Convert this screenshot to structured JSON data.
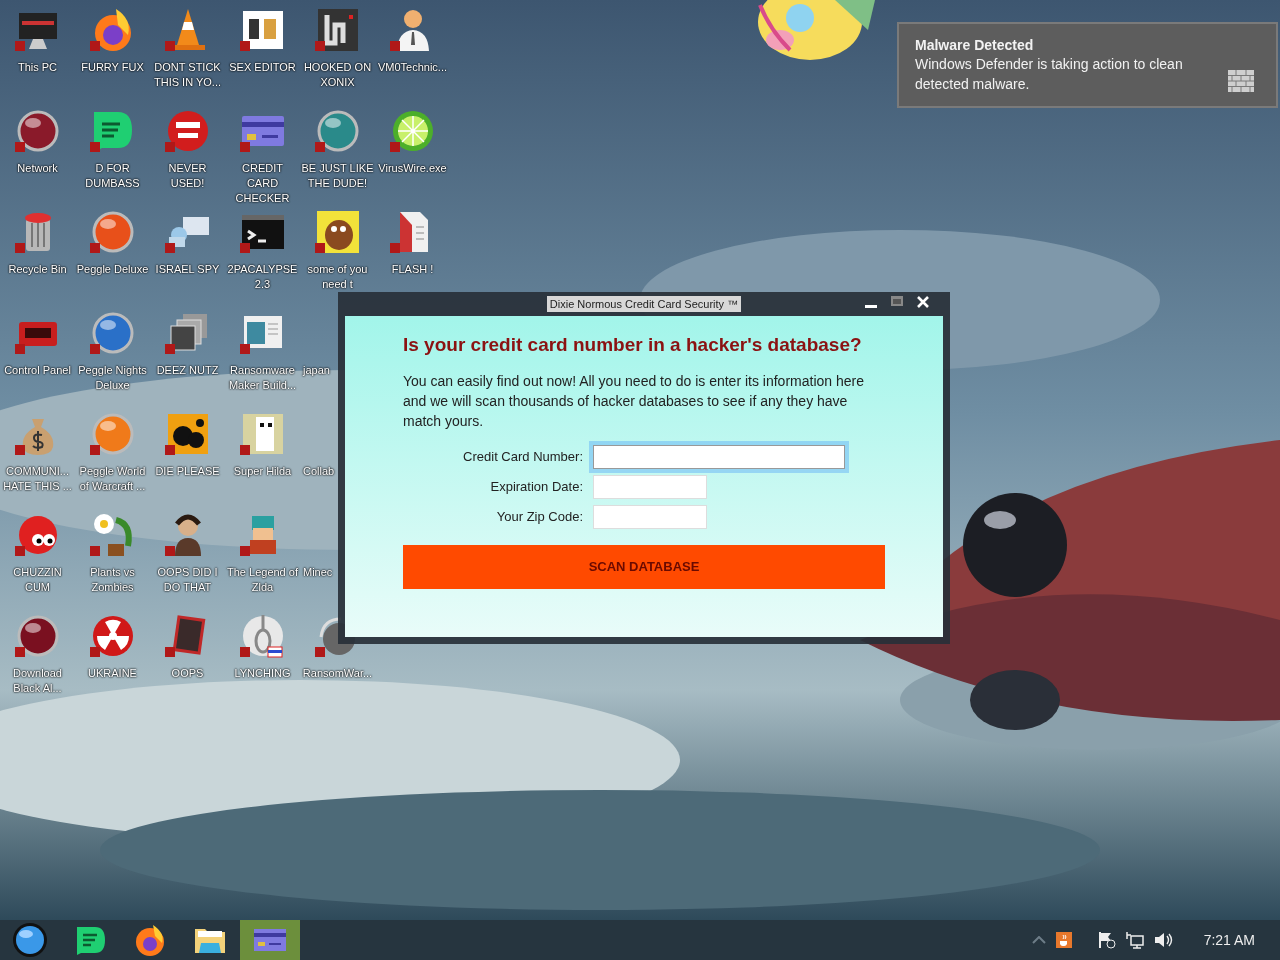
{
  "desktop_rows": [
    [
      {
        "label": "This PC",
        "covered": false
      },
      {
        "label": "FURRY FUX",
        "covered": false
      },
      {
        "label": "DONT STICK THIS IN YO...",
        "covered": false
      },
      {
        "label": "SEX EDITOR",
        "covered": false
      },
      {
        "label": "HOOKED ON XONIX",
        "covered": false
      },
      {
        "label": "VM0Technic...",
        "covered": false
      }
    ],
    [
      {
        "label": "Network",
        "covered": false
      },
      {
        "label": "D FOR DUMBASS",
        "covered": false
      },
      {
        "label": "NEVER USED!",
        "covered": false
      },
      {
        "label": "CREDIT CARD CHECKER",
        "covered": false
      },
      {
        "label": "BE JUST LIKE THE DUDE!",
        "covered": false
      },
      {
        "label": "VirusWire.exe",
        "covered": false
      }
    ],
    [
      {
        "label": "Recycle Bin",
        "covered": false
      },
      {
        "label": "Peggle Deluxe",
        "covered": false
      },
      {
        "label": "ISRAEL SPY",
        "covered": false
      },
      {
        "label": "2PACALYPSE 2.3",
        "covered": false
      },
      {
        "label": "some of you need t",
        "covered": false
      },
      {
        "label": "FLASH !",
        "covered": false
      }
    ],
    [
      {
        "label": "Control Panel",
        "covered": false
      },
      {
        "label": "Peggle Nights Deluxe",
        "covered": false
      },
      {
        "label": "DEEZ NUTZ",
        "covered": false
      },
      {
        "label": "Ransomware Maker Build...",
        "covered": false
      },
      {
        "label": "japan",
        "covered": true
      }
    ],
    [
      {
        "label": "COMMUNI... HATE THIS ...",
        "covered": false
      },
      {
        "label": "Peggle World of Warcraft ...",
        "covered": false
      },
      {
        "label": "DIE PLEASE",
        "covered": false
      },
      {
        "label": "Super Hilda",
        "covered": false
      },
      {
        "label": "Collab",
        "covered": true
      }
    ],
    [
      {
        "label": "CHUZZIN CUM",
        "covered": false
      },
      {
        "label": "Plants vs Zombies",
        "covered": false
      },
      {
        "label": "OOPS DID I DO THAT",
        "covered": false
      },
      {
        "label": "The Legend of Zlda",
        "covered": false
      },
      {
        "label": "Minec",
        "covered": true
      }
    ],
    [
      {
        "label": "Download Black Al...",
        "covered": false
      },
      {
        "label": "UKRAINE",
        "covered": false
      },
      {
        "label": "OOPS",
        "covered": false
      },
      {
        "label": "LYNCHING",
        "covered": false
      },
      {
        "label": "RansomWar...",
        "covered": false
      }
    ]
  ],
  "notification": {
    "title": "Malware Detected",
    "body": "Windows Defender is taking action to clean detected malware."
  },
  "window": {
    "title": "Dixie Normous Credit Card Security ™",
    "heading": "Is your credit card number in a hacker's database?",
    "text": "You can easily find out now! All you need to do is enter its information here and we will scan thousands of hacker databases to see if any they have match yours.",
    "fields": [
      {
        "label": "Credit Card Number:",
        "focused": true
      },
      {
        "label": "Expiration Date:",
        "focused": false
      },
      {
        "label": "Your Zip Code:",
        "focused": false
      }
    ],
    "button": "SCAN DATABASE"
  },
  "taskbar": {
    "apps": [
      {
        "selected": false
      },
      {
        "selected": false
      },
      {
        "selected": false
      },
      {
        "selected": false
      },
      {
        "selected": true
      }
    ],
    "clock": "7:21 AM"
  }
}
